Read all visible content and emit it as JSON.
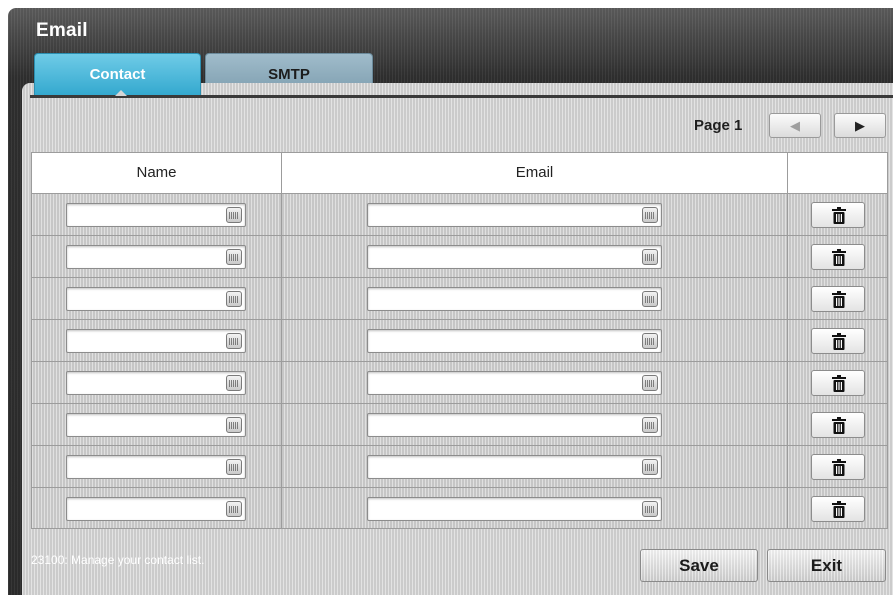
{
  "window": {
    "title": "Email"
  },
  "tabs": [
    {
      "label": "Contact",
      "active": true
    },
    {
      "label": "SMTP",
      "active": false
    }
  ],
  "pager": {
    "label": "Page 1",
    "prev_icon": "triangle-left-icon",
    "next_icon": "triangle-right-icon"
  },
  "table": {
    "columns": [
      "Name",
      "Email",
      ""
    ],
    "rows": [
      {
        "name": "",
        "email": ""
      },
      {
        "name": "",
        "email": ""
      },
      {
        "name": "",
        "email": ""
      },
      {
        "name": "",
        "email": ""
      },
      {
        "name": "",
        "email": ""
      },
      {
        "name": "",
        "email": ""
      },
      {
        "name": "",
        "email": ""
      },
      {
        "name": "",
        "email": ""
      }
    ],
    "input_icon": "keyboard-icon",
    "delete_icon": "trash-icon"
  },
  "status": {
    "text": "23100: Manage your contact list."
  },
  "buttons": {
    "save": "Save",
    "exit": "Exit"
  },
  "colors": {
    "active_tab": "#34a9cf",
    "inactive_tab": "#7d9dae",
    "header_bg": "#3a3a3a"
  }
}
